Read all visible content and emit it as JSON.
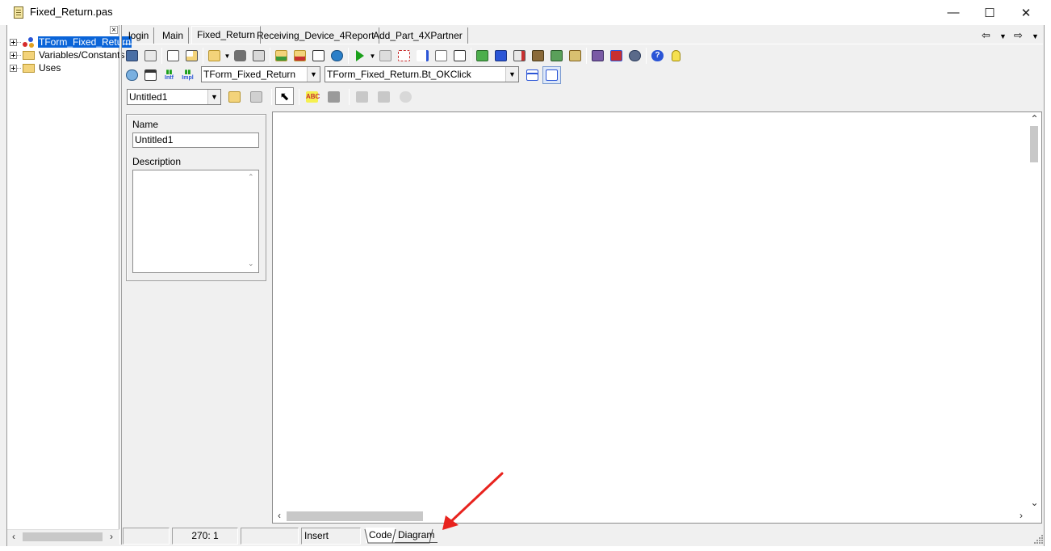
{
  "window": {
    "title": "Fixed_Return.pas",
    "controls": {
      "minimize": "—",
      "maximize": "☐",
      "close": "✕"
    }
  },
  "tree": {
    "close_glyph": "×",
    "items": [
      {
        "label": "TForm_Fixed_Return",
        "selected": true,
        "icon": "class-icon"
      },
      {
        "label": "Variables/Constants",
        "selected": false,
        "icon": "folder-icon"
      },
      {
        "label": "Uses",
        "selected": false,
        "icon": "folder-icon"
      }
    ]
  },
  "tabs": [
    "login",
    "Main",
    "Fixed_Return",
    "Receiving_Device_4Report",
    "Add_Part_4XPartner"
  ],
  "active_tab": "Fixed_Return",
  "tab_nav": {
    "back": "⇦",
    "forward": "⇨",
    "dropdown": "▼"
  },
  "toolbar2": {
    "class_combo": "TForm_Fixed_Return",
    "method_combo": "TForm_Fixed_Return.Bt_OKClick",
    "intf_label": "Intf",
    "impl_label": "Impl"
  },
  "toolbar3": {
    "diagram_combo": "Untitled1"
  },
  "properties": {
    "name_label": "Name",
    "name_value": "Untitled1",
    "description_label": "Description",
    "description_value": ""
  },
  "statusbar": {
    "cell1": "",
    "position": "270:   1",
    "cell3": "",
    "mode": "Insert",
    "view_tabs": [
      "Code",
      "Diagram"
    ]
  },
  "colors": {
    "selection": "#0a64d8",
    "annotation_arrow": "#e8231e"
  }
}
